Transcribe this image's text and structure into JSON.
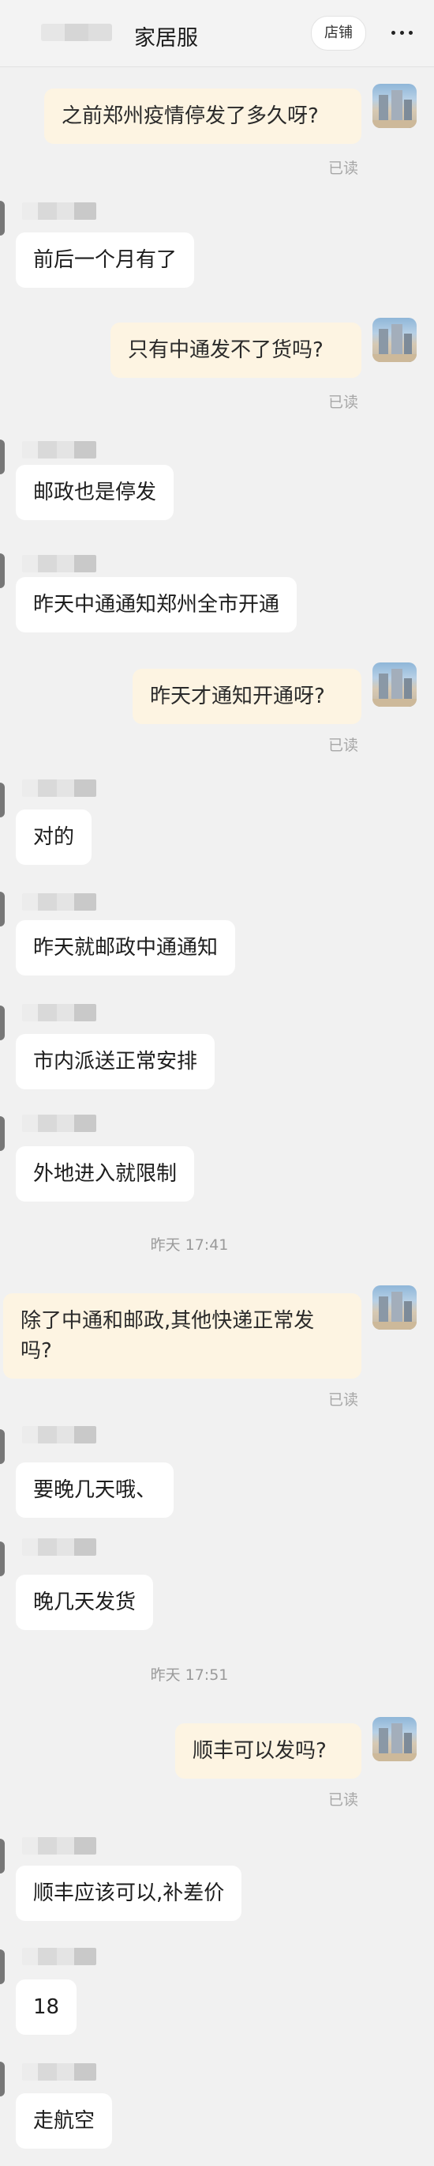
{
  "header": {
    "title": "家居服",
    "shop_label": "店铺"
  },
  "messages": {
    "m1": "之前郑州疫情停发了多久呀?",
    "m2": "前后一个月有了",
    "m3": "只有中通发不了货吗?",
    "m4": "邮政也是停发",
    "m5": "昨天中通通知郑州全市开通",
    "m6": "昨天才通知开通呀?",
    "m7": "对的",
    "m8": "昨天就邮政中通通知",
    "m9": "市内派送正常安排",
    "m10": "外地进入就限制",
    "m11": "除了中通和邮政,其他快递正常发吗?",
    "m12": "要晚几天哦、",
    "m13": "晚几天发货",
    "m14": "顺丰可以发吗?",
    "m15": "顺丰应该可以,补差价",
    "m16": "18",
    "m17": "走航空"
  },
  "read_receipt": "已读",
  "timestamps": {
    "t1": "昨天 17:41",
    "t2": "昨天 17:51"
  }
}
